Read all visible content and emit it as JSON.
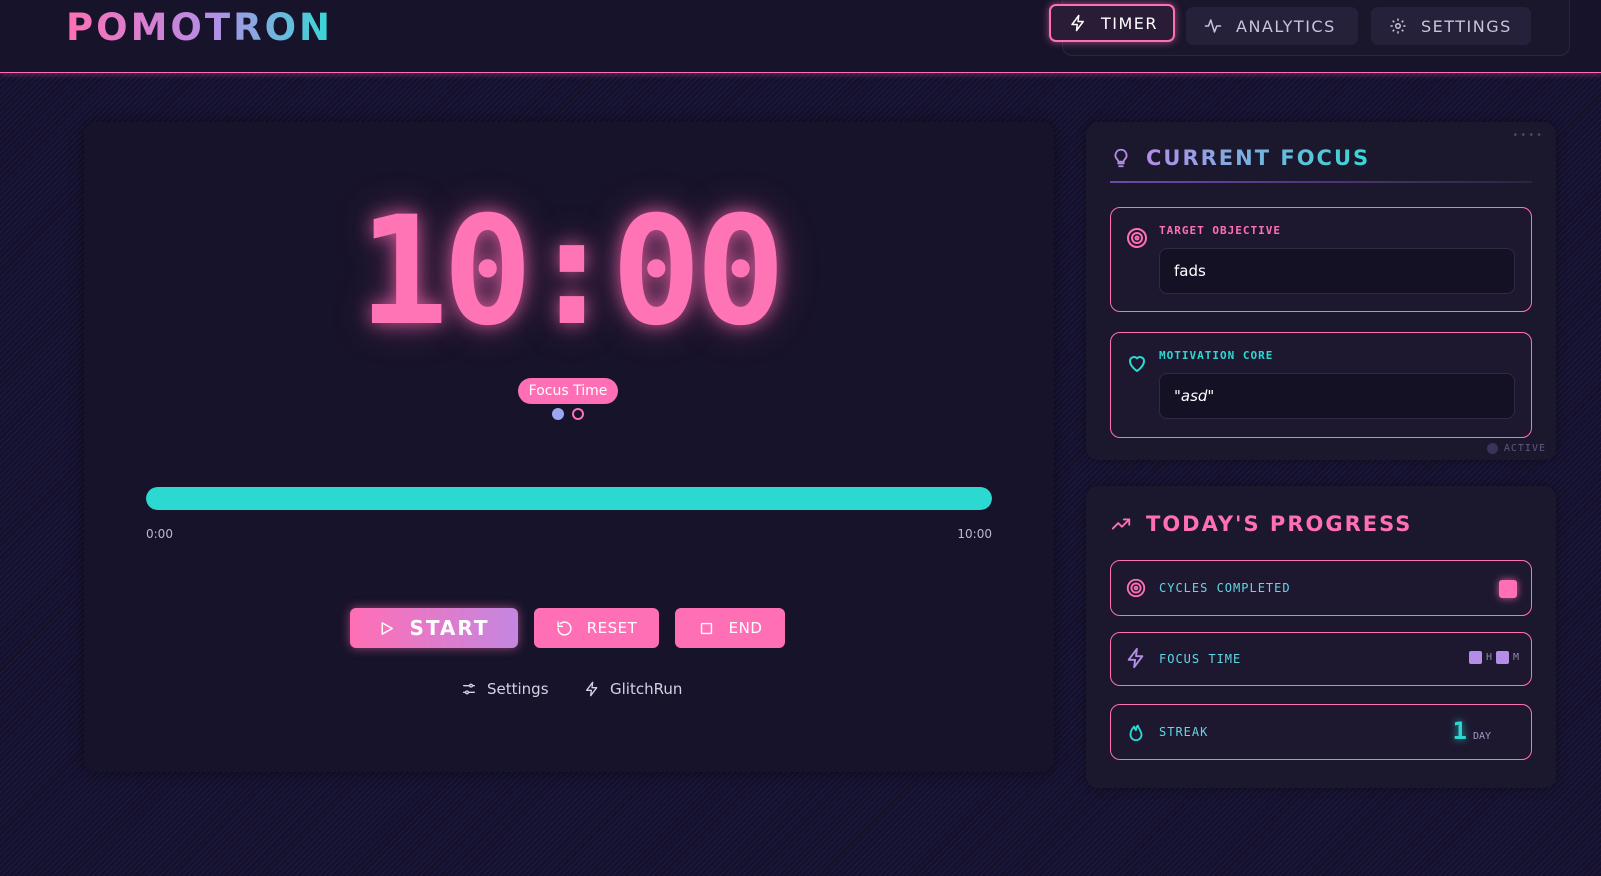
{
  "app": {
    "name": "POMOTRON"
  },
  "nav": {
    "items": [
      {
        "label": "TIMER",
        "icon": "lightning-icon",
        "active": true
      },
      {
        "label": "ANALYTICS",
        "icon": "activity-icon",
        "active": false
      },
      {
        "label": "SETTINGS",
        "icon": "gear-icon",
        "active": false
      }
    ]
  },
  "timer": {
    "display": "10:00",
    "mode": "Focus Time",
    "session_dots": [
      true,
      false
    ],
    "progress": 1.0,
    "progress_start": "0:00",
    "progress_end": "10:00",
    "start_label": "START",
    "reset_label": "RESET",
    "end_label": "END",
    "settings_link": "Settings",
    "glitchrun_link": "GlitchRun"
  },
  "focus": {
    "title": "CURRENT FOCUS",
    "objective_label": "TARGET OBJECTIVE",
    "objective_value": "fads",
    "motivation_label": "MOTIVATION CORE",
    "motivation_value": "\"asd\"",
    "status": "ACTIVE"
  },
  "progress": {
    "title": "TODAY'S PROGRESS",
    "cycles_label": "CYCLES COMPLETED",
    "focus_time_label": "FOCUS TIME",
    "hours_unit": "H",
    "minutes_unit": "M",
    "streak_label": "STREAK",
    "streak_value": "1",
    "streak_unit": "DAY"
  },
  "colors": {
    "accent_pink": "#ff6fb5",
    "accent_cyan": "#2bd9d2",
    "accent_purple": "#b48ee6",
    "background": "#15112a"
  }
}
